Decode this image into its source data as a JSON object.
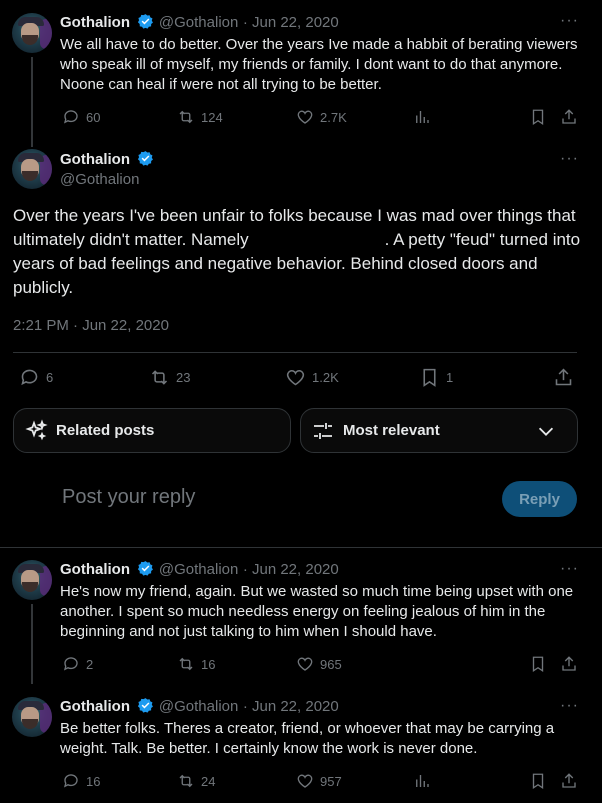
{
  "tweets_top": {
    "name": "Gothalion",
    "handle": "@Gothalion",
    "date": "· Jun 22, 2020",
    "text": "We all have to do better. Over the years Ive made a habbit of berating viewers who speak ill of myself, my friends or family. I dont want to do that anymore. Noone can heal if were not all trying to be better.",
    "replies": "60",
    "retweets": "124",
    "likes": "2.7K"
  },
  "main_tweet": {
    "name": "Gothalion",
    "handle": "@Gothalion",
    "text_part1": "Over the years I've been unfair to folks because I was mad over things that ultimately didn't matter. Namely",
    "text_part2": ". A petty \"feud\" turned into years of bad feelings and negative behavior. Behind closed doors and publicly.",
    "timestamp": "2:21 PM · Jun 22, 2020",
    "replies": "6",
    "retweets": "23",
    "likes": "1.2K",
    "bookmarks": "1"
  },
  "filters": {
    "related_label": "Related posts",
    "relevant_label": "Most relevant"
  },
  "composer": {
    "placeholder": "Post your reply",
    "reply_label": "Reply"
  },
  "replies": [
    {
      "name": "Gothalion",
      "handle": "@Gothalion",
      "date": "· Jun 22, 2020",
      "text": "He's now my friend, again. But we wasted so much time being upset with one another. I spent so much needless energy on feeling jealous of him in the beginning and not just talking to him when I should have.",
      "replies": "2",
      "retweets": "16",
      "likes": "965"
    },
    {
      "name": "Gothalion",
      "handle": "@Gothalion",
      "date": "· Jun 22, 2020",
      "text": "Be better folks. Theres a creator, friend, or whoever that may be carrying a weight. Talk. Be better. I certainly know the work is never done.",
      "replies": "16",
      "retweets": "24",
      "likes": "957"
    }
  ],
  "colors": {
    "background": "#000000",
    "text": "#e7e9ea",
    "muted": "#71767b",
    "verified": "#1d9bf0",
    "reply_button": "#0e4f78"
  }
}
